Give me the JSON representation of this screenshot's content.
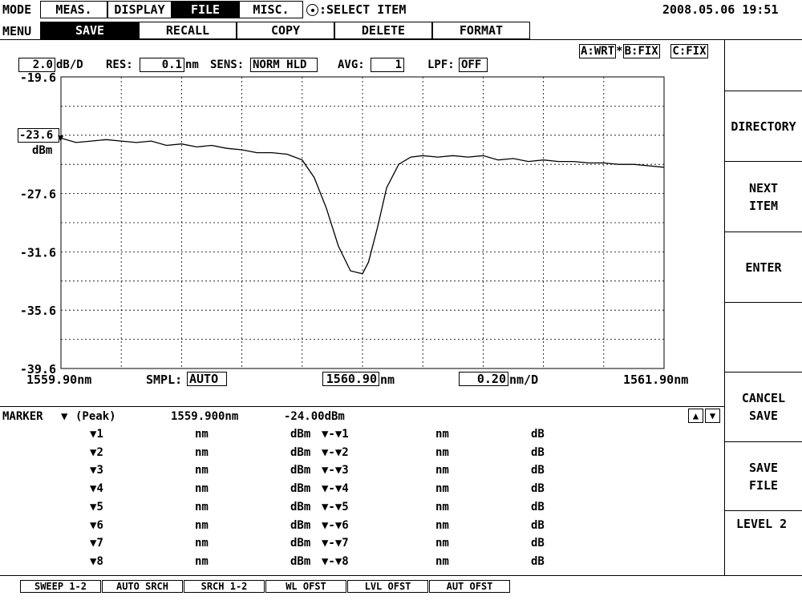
{
  "header": {
    "mode_label": "MODE",
    "mode_tabs": [
      "MEAS.",
      "DISPLAY",
      "FILE",
      "MISC."
    ],
    "active_tab_index": 2,
    "select_hint": ":SELECT ITEM",
    "datetime": "2008.05.06 19:51"
  },
  "menu": {
    "label": "MENU",
    "items": [
      "SAVE",
      "RECALL",
      "COPY",
      "DELETE",
      "FORMAT"
    ],
    "active_index": 0
  },
  "traces": {
    "a": "A:WRT",
    "sep": "*",
    "b": "B:FIX",
    "c": "C:FIX"
  },
  "settings": {
    "scale_value": "2.0",
    "scale_unit": "dB/D",
    "res_label": "RES:",
    "res_value": "0.1",
    "res_unit": "nm",
    "sens_label": "SENS:",
    "sens_value": "NORM HLD",
    "avg_label": "AVG:",
    "avg_value": "1",
    "lpf_label": "LPF:",
    "lpf_value": "OFF"
  },
  "bottom_axis": {
    "start": "1559.90nm",
    "smpl_label": "SMPL:",
    "smpl_value": "AUTO",
    "center_value": "1560.90",
    "center_unit": "nm",
    "span_value": "0.20",
    "span_unit": "nm/D",
    "stop": "1561.90nm"
  },
  "chart_data": {
    "type": "line",
    "xlabel": "",
    "ylabel": "",
    "y_unit": "dBm",
    "ref_level": "-23.6",
    "y_tick_labels": [
      "-19.6",
      "-23.6",
      "-27.6",
      "-31.6",
      "-35.6",
      "-39.6"
    ],
    "xlim": [
      1559.9,
      1561.9
    ],
    "ylim": [
      -39.6,
      -19.6
    ],
    "grid": true,
    "series": [
      {
        "x": [
          1559.9,
          1559.95,
          1560.0,
          1560.05,
          1560.1,
          1560.15,
          1560.2,
          1560.25,
          1560.3,
          1560.35,
          1560.4,
          1560.45,
          1560.5,
          1560.55,
          1560.6,
          1560.65,
          1560.7,
          1560.74,
          1560.78,
          1560.82,
          1560.86,
          1560.9,
          1560.92,
          1560.95,
          1560.98,
          1561.02,
          1561.06,
          1561.1,
          1561.15,
          1561.2,
          1561.25,
          1561.3,
          1561.35,
          1561.4,
          1561.45,
          1561.5,
          1561.55,
          1561.6,
          1561.65,
          1561.7,
          1561.75,
          1561.8,
          1561.85,
          1561.9
        ],
        "values": [
          -23.8,
          -24.1,
          -24.0,
          -23.9,
          -24.0,
          -24.1,
          -24.0,
          -24.3,
          -24.2,
          -24.4,
          -24.3,
          -24.5,
          -24.6,
          -24.8,
          -24.8,
          -24.9,
          -25.3,
          -26.5,
          -28.6,
          -31.2,
          -32.9,
          -33.1,
          -32.3,
          -29.9,
          -27.2,
          -25.6,
          -25.1,
          -25.0,
          -25.1,
          -25.0,
          -25.1,
          -25.0,
          -25.3,
          -25.2,
          -25.4,
          -25.3,
          -25.4,
          -25.4,
          -25.5,
          -25.5,
          -25.6,
          -25.6,
          -25.7,
          -25.8
        ]
      }
    ]
  },
  "marker_panel": {
    "title": "MARKER",
    "mode": "(Peak)",
    "marker_wl": "1559.900nm",
    "marker_level": "-24.00dBm",
    "rows": [
      {
        "id": "1",
        "nm": "nm",
        "dbm": "dBm",
        "delta": "▼-▼1",
        "dnm": "nm",
        "db": "dB"
      },
      {
        "id": "2",
        "nm": "nm",
        "dbm": "dBm",
        "delta": "▼-▼2",
        "dnm": "nm",
        "db": "dB"
      },
      {
        "id": "3",
        "nm": "nm",
        "dbm": "dBm",
        "delta": "▼-▼3",
        "dnm": "nm",
        "db": "dB"
      },
      {
        "id": "4",
        "nm": "nm",
        "dbm": "dBm",
        "delta": "▼-▼4",
        "dnm": "nm",
        "db": "dB"
      },
      {
        "id": "5",
        "nm": "nm",
        "dbm": "dBm",
        "delta": "▼-▼5",
        "dnm": "nm",
        "db": "dB"
      },
      {
        "id": "6",
        "nm": "nm",
        "dbm": "dBm",
        "delta": "▼-▼6",
        "dnm": "nm",
        "db": "dB"
      },
      {
        "id": "7",
        "nm": "nm",
        "dbm": "dBm",
        "delta": "▼-▼7",
        "dnm": "nm",
        "db": "dB"
      },
      {
        "id": "8",
        "nm": "nm",
        "dbm": "dBm",
        "delta": "▼-▼8",
        "dnm": "nm",
        "db": "dB"
      }
    ]
  },
  "softkeys": [
    "",
    "DIRECTORY",
    "NEXT\nITEM",
    "ENTER",
    "",
    "CANCEL\nSAVE",
    "SAVE\nFILE"
  ],
  "level_label": "LEVEL 2",
  "bottom_buttons": [
    "SWEEP 1-2",
    "AUTO SRCH",
    "SRCH 1-2",
    "WL OFST",
    "LVL OFST",
    "AUT OFST"
  ]
}
